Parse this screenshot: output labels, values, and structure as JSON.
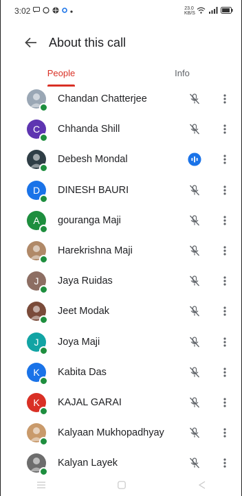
{
  "status_bar": {
    "time": "3:02",
    "left_icons": [
      "message-icon",
      "whatsapp-icon",
      "vpn-icon",
      "dot-icon"
    ],
    "network_speed": "23.0 KB/S",
    "right_icons": [
      "wifi-icon",
      "signal-icon",
      "battery-icon"
    ]
  },
  "header": {
    "title": "About this call"
  },
  "tabs": [
    {
      "label": "People",
      "active": true
    },
    {
      "label": "Info",
      "active": false
    }
  ],
  "participants": [
    {
      "name": "Chandan Chatterjee",
      "avatar": "photo",
      "avatar_color": "#9aa7b5",
      "mic": "muted"
    },
    {
      "name": "Chhanda Shill",
      "avatar": "C",
      "avatar_color": "#5e35b1",
      "mic": "muted"
    },
    {
      "name": "Debesh Mondal",
      "avatar": "photo",
      "avatar_color": "#2f3e46",
      "mic": "speaking"
    },
    {
      "name": "DINESH BAURI",
      "avatar": "D",
      "avatar_color": "#1a73e8",
      "mic": "muted"
    },
    {
      "name": "gouranga Maji",
      "avatar": "A",
      "avatar_color": "#1e8e3e",
      "mic": "muted"
    },
    {
      "name": "Harekrishna Maji",
      "avatar": "photo",
      "avatar_color": "#b08968",
      "mic": "muted"
    },
    {
      "name": "Jaya Ruidas",
      "avatar": "J",
      "avatar_color": "#8d6e63",
      "mic": "muted"
    },
    {
      "name": "Jeet Modak",
      "avatar": "photo",
      "avatar_color": "#7a4b3a",
      "mic": "muted"
    },
    {
      "name": "Joya Maji",
      "avatar": "J",
      "avatar_color": "#12a4a4",
      "mic": "muted"
    },
    {
      "name": "Kabita Das",
      "avatar": "K",
      "avatar_color": "#1a73e8",
      "mic": "muted"
    },
    {
      "name": "KAJAL GARAI",
      "avatar": "K",
      "avatar_color": "#d93025",
      "mic": "muted"
    },
    {
      "name": "Kalyaan Mukhopadhyay",
      "avatar": "photo",
      "avatar_color": "#c99a6b",
      "mic": "muted"
    },
    {
      "name": "Kalyan Layek",
      "avatar": "photo",
      "avatar_color": "#6d6d6d",
      "mic": "muted"
    }
  ],
  "colors": {
    "accent": "#d93025",
    "speaking": "#1a73e8",
    "online_dot": "#1e8e3e"
  },
  "nav_bar": [
    "menu-icon",
    "home-icon",
    "back-icon"
  ]
}
